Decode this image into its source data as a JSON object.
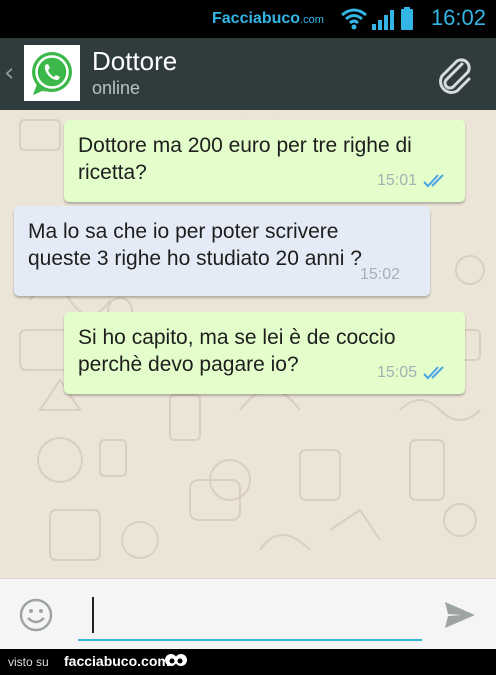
{
  "status_bar": {
    "watermark": "Facciabuco",
    "watermark_suffix": ".com",
    "time": "16:02"
  },
  "header": {
    "back_icon": "chevron-left-icon",
    "avatar_icon": "whatsapp-logo-icon",
    "contact_name": "Dottore",
    "contact_status": "online",
    "attach_icon": "paperclip-icon"
  },
  "messages": [
    {
      "direction": "outgoing",
      "text_lines": [
        "Dottore ma 200 euro per tre righe di",
        "ricetta?"
      ],
      "time": "15:01",
      "status": "read"
    },
    {
      "direction": "incoming",
      "text_lines": [
        "Ma lo sa che io per poter scrivere",
        "queste 3 righe ho studiato 20 anni ?"
      ],
      "time": "15:02"
    },
    {
      "direction": "outgoing",
      "text_lines": [
        "Si ho capito, ma se lei è de coccio",
        "perchè devo pagare io?"
      ],
      "time": "15:05",
      "status": "read"
    }
  ],
  "input_bar": {
    "emoji_icon": "smiley-icon",
    "value": "",
    "send_icon": "send-icon"
  },
  "footer": {
    "prefix": "visto su",
    "site": "facciabuco.com"
  },
  "colors": {
    "accent": "#33b5e5",
    "header_bg": "#2f3b3d",
    "chat_bg": "#ece5d7",
    "outgoing_bubble": "#e3fdcb",
    "incoming_bubble": "#e4ebf6",
    "read_ticks": "#4fa3e6"
  }
}
